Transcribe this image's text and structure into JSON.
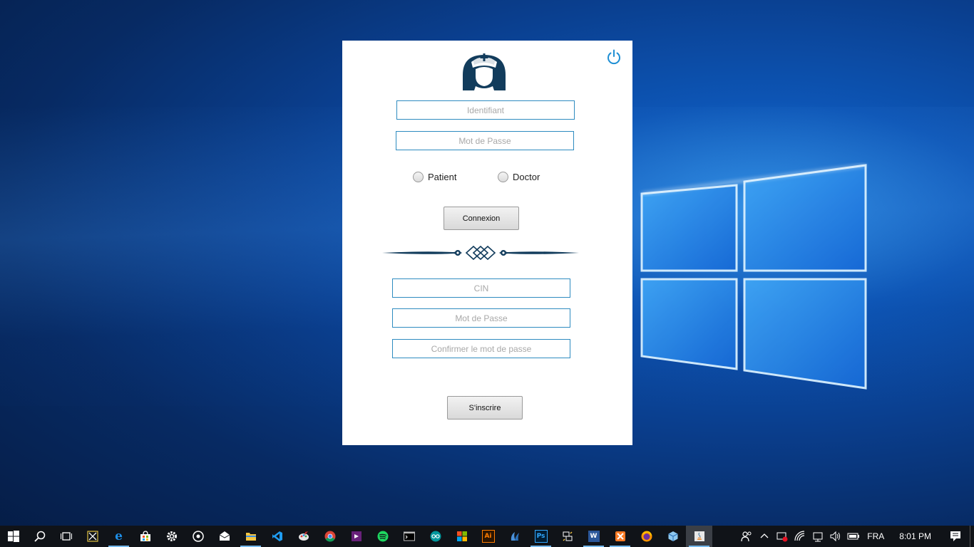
{
  "login": {
    "username_placeholder": "Identifiant",
    "password_placeholder": "Mot de Passe",
    "radio_patient": "Patient",
    "radio_doctor": "Doctor",
    "connect_label": "Connexion"
  },
  "register": {
    "cin_placeholder": "CIN",
    "password_placeholder": "Mot de Passe",
    "confirm_placeholder": "Confirmer le mot de passe",
    "register_label": "S'inscrire"
  },
  "colors": {
    "accent": "#2e8bc0",
    "logo": "#123c5c",
    "power": "#1f8fd4"
  },
  "taskbar": {
    "apps": [
      "start-icon",
      "search-icon",
      "task-view-icon",
      "snipping-tool-icon",
      "edge-icon",
      "store-icon",
      "settings-icon",
      "groove-icon",
      "mail-icon",
      "file-explorer-icon",
      "vscode-icon",
      "paint-icon",
      "chrome-icon",
      "visual-studio-icon",
      "spotify-icon",
      "cmd-icon",
      "arduino-icon",
      "office-icon",
      "illustrator-icon",
      "app-icon",
      "photoshop-icon",
      "network-tool-icon",
      "word-icon",
      "xampp-icon",
      "firefox-icon",
      "virtualbox-icon",
      "java-app-icon"
    ],
    "language": "FRA",
    "time": "8:01 PM",
    "illustrator_label": "Ai",
    "photoshop_label": "Ps",
    "word_label": "W"
  }
}
